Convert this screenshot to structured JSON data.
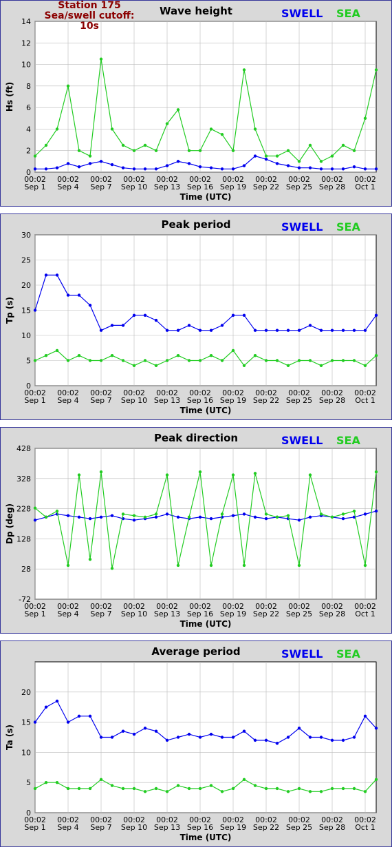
{
  "station": {
    "name": "Station 175",
    "cutoff": "Sea/swell cutoff: 10s"
  },
  "legend": {
    "swell": "SWELL",
    "sea": "SEA"
  },
  "colors": {
    "swell": "#0000ee",
    "sea": "#22cc22",
    "panel_bg": "#d9d9d9",
    "plot_bg": "#ffffff",
    "grid": "#bbbbbb"
  },
  "xaxis": {
    "label": "Time (UTC)",
    "time_label": "00:02",
    "dates": [
      "Sep 1",
      "Sep 4",
      "Sep 7",
      "Sep 10",
      "Sep 13",
      "Sep 16",
      "Sep 19",
      "Sep 22",
      "Sep 25",
      "Sep 28",
      "Oct 1"
    ]
  },
  "chart_data": [
    {
      "type": "line",
      "title": "Wave height",
      "ylabel": "Hs (ft)",
      "ylim": [
        0,
        14
      ],
      "yticks": [
        "0",
        "2",
        "4",
        "6",
        "8",
        "10",
        "12",
        "14"
      ],
      "x": [
        "Sep 1",
        "Sep 2",
        "Sep 3",
        "Sep 4",
        "Sep 5",
        "Sep 6",
        "Sep 7",
        "Sep 8",
        "Sep 9",
        "Sep 10",
        "Sep 11",
        "Sep 12",
        "Sep 13",
        "Sep 14",
        "Sep 15",
        "Sep 16",
        "Sep 17",
        "Sep 18",
        "Sep 19",
        "Sep 20",
        "Sep 21",
        "Sep 22",
        "Sep 23",
        "Sep 24",
        "Sep 25",
        "Sep 26",
        "Sep 27",
        "Sep 28",
        "Sep 29",
        "Sep 30",
        "Oct 1",
        "Oct 2"
      ],
      "series": [
        {
          "name": "SWELL",
          "values": [
            0.3,
            0.3,
            0.4,
            0.8,
            0.5,
            0.8,
            1.0,
            0.7,
            0.4,
            0.3,
            0.3,
            0.3,
            0.6,
            1.0,
            0.8,
            0.5,
            0.4,
            0.3,
            0.3,
            0.6,
            1.5,
            1.2,
            0.8,
            0.6,
            0.4,
            0.4,
            0.3,
            0.3,
            0.3,
            0.5,
            0.3,
            0.3
          ]
        },
        {
          "name": "SEA",
          "values": [
            1.5,
            2.5,
            4.0,
            8.0,
            2.0,
            1.5,
            10.5,
            4.0,
            2.5,
            2.0,
            2.5,
            2.0,
            4.5,
            5.8,
            2.0,
            2.0,
            4.0,
            3.5,
            2.0,
            9.5,
            4.0,
            1.5,
            1.5,
            2.0,
            1.0,
            2.5,
            1.0,
            1.5,
            2.5,
            2.0,
            5.0,
            9.5
          ]
        }
      ]
    },
    {
      "type": "line",
      "title": "Peak period",
      "ylabel": "Tp (s)",
      "ylim": [
        0,
        30
      ],
      "yticks": [
        "0",
        "5",
        "10",
        "15",
        "20",
        "25",
        "30"
      ],
      "x": [
        "Sep 1",
        "Sep 2",
        "Sep 3",
        "Sep 4",
        "Sep 5",
        "Sep 6",
        "Sep 7",
        "Sep 8",
        "Sep 9",
        "Sep 10",
        "Sep 11",
        "Sep 12",
        "Sep 13",
        "Sep 14",
        "Sep 15",
        "Sep 16",
        "Sep 17",
        "Sep 18",
        "Sep 19",
        "Sep 20",
        "Sep 21",
        "Sep 22",
        "Sep 23",
        "Sep 24",
        "Sep 25",
        "Sep 26",
        "Sep 27",
        "Sep 28",
        "Sep 29",
        "Sep 30",
        "Oct 1",
        "Oct 2"
      ],
      "series": [
        {
          "name": "SWELL",
          "values": [
            15,
            22,
            22,
            18,
            18,
            16,
            11,
            12,
            12,
            14,
            14,
            13,
            11,
            11,
            12,
            11,
            11,
            12,
            14,
            14,
            11,
            11,
            11,
            11,
            11,
            12,
            11,
            11,
            11,
            11,
            11,
            14
          ]
        },
        {
          "name": "SEA",
          "values": [
            5,
            6,
            7,
            5,
            6,
            5,
            5,
            6,
            5,
            4,
            5,
            4,
            5,
            6,
            5,
            5,
            6,
            5,
            7,
            4,
            6,
            5,
            5,
            4,
            5,
            5,
            4,
            5,
            5,
            5,
            4,
            6
          ]
        }
      ]
    },
    {
      "type": "line",
      "title": "Peak direction",
      "ylabel": "Dp (deg)",
      "ylim": [
        -72,
        428
      ],
      "yticks": [
        "-72",
        "28",
        "128",
        "228",
        "328",
        "428"
      ],
      "x": [
        "Sep 1",
        "Sep 2",
        "Sep 3",
        "Sep 4",
        "Sep 5",
        "Sep 6",
        "Sep 7",
        "Sep 8",
        "Sep 9",
        "Sep 10",
        "Sep 11",
        "Sep 12",
        "Sep 13",
        "Sep 14",
        "Sep 15",
        "Sep 16",
        "Sep 17",
        "Sep 18",
        "Sep 19",
        "Sep 20",
        "Sep 21",
        "Sep 22",
        "Sep 23",
        "Sep 24",
        "Sep 25",
        "Sep 26",
        "Sep 27",
        "Sep 28",
        "Sep 29",
        "Sep 30",
        "Oct 1",
        "Oct 2"
      ],
      "series": [
        {
          "name": "SWELL",
          "values": [
            190,
            200,
            210,
            205,
            200,
            195,
            200,
            205,
            195,
            190,
            195,
            200,
            210,
            200,
            195,
            200,
            195,
            200,
            205,
            210,
            200,
            195,
            200,
            195,
            190,
            200,
            205,
            200,
            195,
            200,
            210,
            220
          ]
        },
        {
          "name": "SEA",
          "values": [
            230,
            200,
            220,
            40,
            340,
            60,
            350,
            30,
            210,
            205,
            200,
            210,
            340,
            40,
            200,
            350,
            40,
            210,
            340,
            40,
            345,
            210,
            200,
            205,
            40,
            340,
            210,
            200,
            210,
            220,
            40,
            350
          ]
        }
      ]
    },
    {
      "type": "line",
      "title": "Average period",
      "ylabel": "Ta (s)",
      "ylim": [
        0,
        25
      ],
      "yticks": [
        "0",
        "5",
        "10",
        "15",
        "20"
      ],
      "x": [
        "Sep 1",
        "Sep 2",
        "Sep 3",
        "Sep 4",
        "Sep 5",
        "Sep 6",
        "Sep 7",
        "Sep 8",
        "Sep 9",
        "Sep 10",
        "Sep 11",
        "Sep 12",
        "Sep 13",
        "Sep 14",
        "Sep 15",
        "Sep 16",
        "Sep 17",
        "Sep 18",
        "Sep 19",
        "Sep 20",
        "Sep 21",
        "Sep 22",
        "Sep 23",
        "Sep 24",
        "Sep 25",
        "Sep 26",
        "Sep 27",
        "Sep 28",
        "Sep 29",
        "Sep 30",
        "Oct 1",
        "Oct 2"
      ],
      "series": [
        {
          "name": "SWELL",
          "values": [
            15,
            17.5,
            18.5,
            15,
            16,
            16,
            12.5,
            12.5,
            13.5,
            13,
            14,
            13.5,
            12,
            12.5,
            13,
            12.5,
            13,
            12.5,
            12.5,
            13.5,
            12,
            12,
            11.5,
            12.5,
            14,
            12.5,
            12.5,
            12,
            12,
            12.5,
            16,
            14
          ]
        },
        {
          "name": "SEA",
          "values": [
            4,
            5,
            5,
            4,
            4,
            4,
            5.5,
            4.5,
            4,
            4,
            3.5,
            4,
            3.5,
            4.5,
            4,
            4,
            4.5,
            3.5,
            4,
            5.5,
            4.5,
            4,
            4,
            3.5,
            4,
            3.5,
            3.5,
            4,
            4,
            4,
            3.5,
            5.5
          ]
        }
      ]
    }
  ]
}
